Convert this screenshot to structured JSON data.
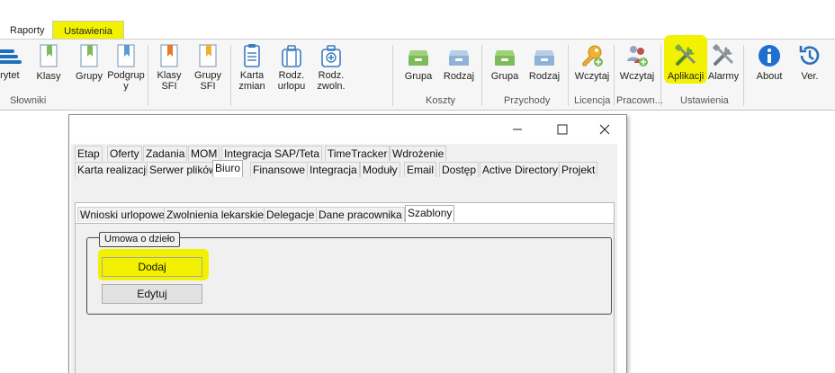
{
  "ribbon": {
    "tabs": [
      {
        "label": "Raporty"
      },
      {
        "label": "Ustawienia"
      }
    ],
    "buttons": [
      {
        "label": "orytet\ny",
        "icon": "priority-icon"
      },
      {
        "label": "Klasy",
        "icon": "bookmark-icon"
      },
      {
        "label": "Grupy",
        "icon": "bookmark-icon"
      },
      {
        "label": "Podgrup\ny",
        "icon": "bookmark-icon"
      },
      {
        "label": "Klasy\nSFI",
        "icon": "bookmark-orange-icon"
      },
      {
        "label": "Grupy\nSFI",
        "icon": "bookmark-orange-icon"
      },
      {
        "label": "Karta\nzmian",
        "icon": "clipboard-icon"
      },
      {
        "label": "Rodz.\nurlopu",
        "icon": "suitcase-icon"
      },
      {
        "label": "Rodz.\nzwoln.",
        "icon": "medical-kit-icon"
      },
      {
        "label": "Grupa",
        "icon": "drawer-green-icon"
      },
      {
        "label": "Rodzaj",
        "icon": "drawer-blue-icon"
      },
      {
        "label": "Grupa",
        "icon": "drawer-green-icon"
      },
      {
        "label": "Rodzaj",
        "icon": "drawer-blue-icon"
      },
      {
        "label": "Wczytaj",
        "icon": "key-icon"
      },
      {
        "label": "Wczytaj",
        "icon": "users-icon"
      },
      {
        "label": "Aplikacji",
        "icon": "tools-icon"
      },
      {
        "label": "Alarmy",
        "icon": "tools-grey-icon"
      },
      {
        "label": "About",
        "icon": "info-icon"
      },
      {
        "label": "Ver.",
        "icon": "history-icon"
      }
    ],
    "groups": [
      {
        "label": "Słowniki"
      },
      {
        "label": "Koszty"
      },
      {
        "label": "Przychody"
      },
      {
        "label": "Licencja"
      },
      {
        "label": "Pracown..."
      },
      {
        "label": "Ustawienia"
      }
    ]
  },
  "dialog": {
    "tabs_row1": [
      "Etap",
      "Oferty",
      "Zadania",
      "MOM",
      "Integracja SAP/Teta",
      "TimeTracker",
      "Wdrożenie"
    ],
    "tabs_row2": [
      "Karta realizacji",
      "Serwer plików",
      "Biuro",
      "Finansowe",
      "Integracja",
      "Moduły",
      "Email",
      "Dostęp",
      "Active Directory",
      "Projekt"
    ],
    "tabs_row3": [
      "Wnioski urlopowe",
      "Zwolnienia lekarskie",
      "Delegacje",
      "Dane pracownika",
      "Szablony"
    ],
    "selected_tab_row2": "Biuro",
    "selected_tab_row3": "Szablony",
    "groupbox_title": "Umowa o dzieło",
    "add_button": "Dodaj",
    "edit_button": "Edytuj"
  },
  "colors": {
    "highlight": "#f2f200",
    "ribbon_bg": "#f6f6f6",
    "dialog_bg": "#f0f0f0"
  }
}
